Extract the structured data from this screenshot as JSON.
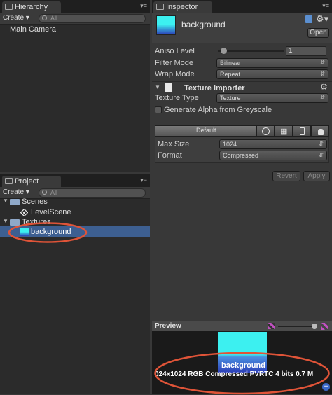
{
  "hierarchy": {
    "tab_label": "Hierarchy",
    "create_label": "Create",
    "search_placeholder": "All",
    "items": [
      "Main Camera"
    ]
  },
  "project": {
    "tab_label": "Project",
    "create_label": "Create",
    "search_placeholder": "All",
    "tree": [
      {
        "label": "Scenes",
        "type": "folder",
        "icon": "folder-icon"
      },
      {
        "label": "LevelScene",
        "type": "scene",
        "icon": "unity-scene-icon"
      },
      {
        "label": "Textures",
        "type": "folder",
        "icon": "folder-icon"
      },
      {
        "label": "background",
        "type": "texture",
        "icon": "texture-thumbnail-icon",
        "selected": true
      }
    ]
  },
  "inspector": {
    "tab_label": "Inspector",
    "asset_name": "background",
    "open_label": "Open",
    "aniso_label": "Aniso Level",
    "aniso_value": "1",
    "filter_mode_label": "Filter Mode",
    "filter_mode_value": "Bilinear",
    "wrap_mode_label": "Wrap Mode",
    "wrap_mode_value": "Repeat",
    "importer_title": "Texture Importer",
    "texture_type_label": "Texture Type",
    "texture_type_value": "Texture",
    "alpha_label": "Generate Alpha from Greyscale",
    "alpha_checked": false,
    "platforms": {
      "default_label": "Default",
      "icons": [
        "globe-icon",
        "windows-icon",
        "iphone-icon",
        "android-icon"
      ]
    },
    "max_size_label": "Max Size",
    "max_size_value": "1024",
    "format_label": "Format",
    "format_value": "Compressed",
    "revert_label": "Revert",
    "apply_label": "Apply"
  },
  "preview": {
    "title": "Preview",
    "name": "background",
    "info": "024x1024  RGB Compressed PVRTC 4 bits  0.7 M"
  },
  "colors": {
    "selection": "#3d5f91",
    "annotation": "#e05438",
    "texture_cyan": "#3cf0f0",
    "texture_blue": "#2d40b8"
  }
}
